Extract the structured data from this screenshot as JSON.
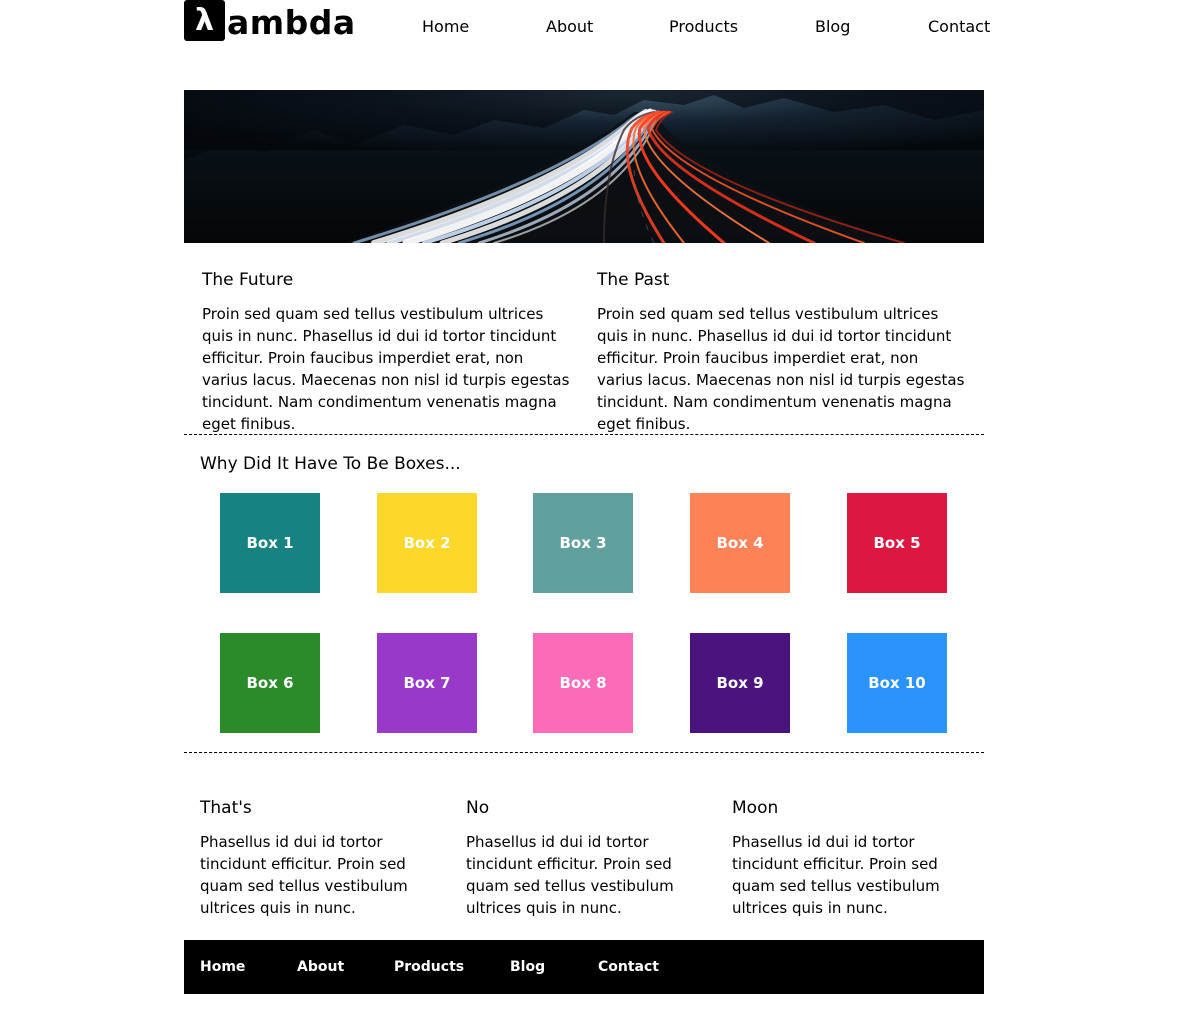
{
  "brand": {
    "logo_glyph": "λ",
    "logo_text": "ambda"
  },
  "nav": {
    "items": [
      "Home",
      "About",
      "Products",
      "Blog",
      "Contact"
    ]
  },
  "hero": {
    "description": "long-exposure highway at night with white and red light trails"
  },
  "intro": {
    "columns": [
      {
        "title": "The Future",
        "body": "Proin sed quam sed tellus vestibulum ultrices quis in nunc. Phasellus id dui id tortor tincidunt efficitur. Proin faucibus imperdiet erat, non varius lacus. Maecenas non nisl id turpis egestas tincidunt. Nam condimentum venenatis magna eget finibus."
      },
      {
        "title": "The Past",
        "body": "Proin sed quam sed tellus vestibulum ultrices quis in nunc. Phasellus id dui id tortor tincidunt efficitur. Proin faucibus imperdiet erat, non varius lacus. Maecenas non nisl id turpis egestas tincidunt. Nam condimentum venenatis magna eget finibus."
      }
    ]
  },
  "boxes": {
    "title": "Why Did It Have To Be Boxes...",
    "items": [
      {
        "label": "Box 1",
        "color": "#178282"
      },
      {
        "label": "Box 2",
        "color": "#fdd72a"
      },
      {
        "label": "Box 3",
        "color": "#62a09f"
      },
      {
        "label": "Box 4",
        "color": "#fe8257"
      },
      {
        "label": "Box 5",
        "color": "#dc1841"
      },
      {
        "label": "Box 6",
        "color": "#2b8b2b"
      },
      {
        "label": "Box 7",
        "color": "#9839c9"
      },
      {
        "label": "Box 8",
        "color": "#fb6bb8"
      },
      {
        "label": "Box 9",
        "color": "#4a137e"
      },
      {
        "label": "Box 10",
        "color": "#2b93fc"
      }
    ]
  },
  "bottom": {
    "columns": [
      {
        "title": "That's",
        "body": "Phasellus id dui id tortor tincidunt efficitur. Proin sed quam sed tellus vestibulum ultrices quis in nunc."
      },
      {
        "title": "No",
        "body": "Phasellus id dui id tortor tincidunt efficitur. Proin sed quam sed tellus vestibulum ultrices quis in nunc."
      },
      {
        "title": "Moon",
        "body": "Phasellus id dui id tortor tincidunt efficitur. Proin sed quam sed tellus vestibulum ultrices quis in nunc."
      }
    ]
  },
  "footer": {
    "items": [
      "Home",
      "About",
      "Products",
      "Blog",
      "Contact"
    ]
  }
}
